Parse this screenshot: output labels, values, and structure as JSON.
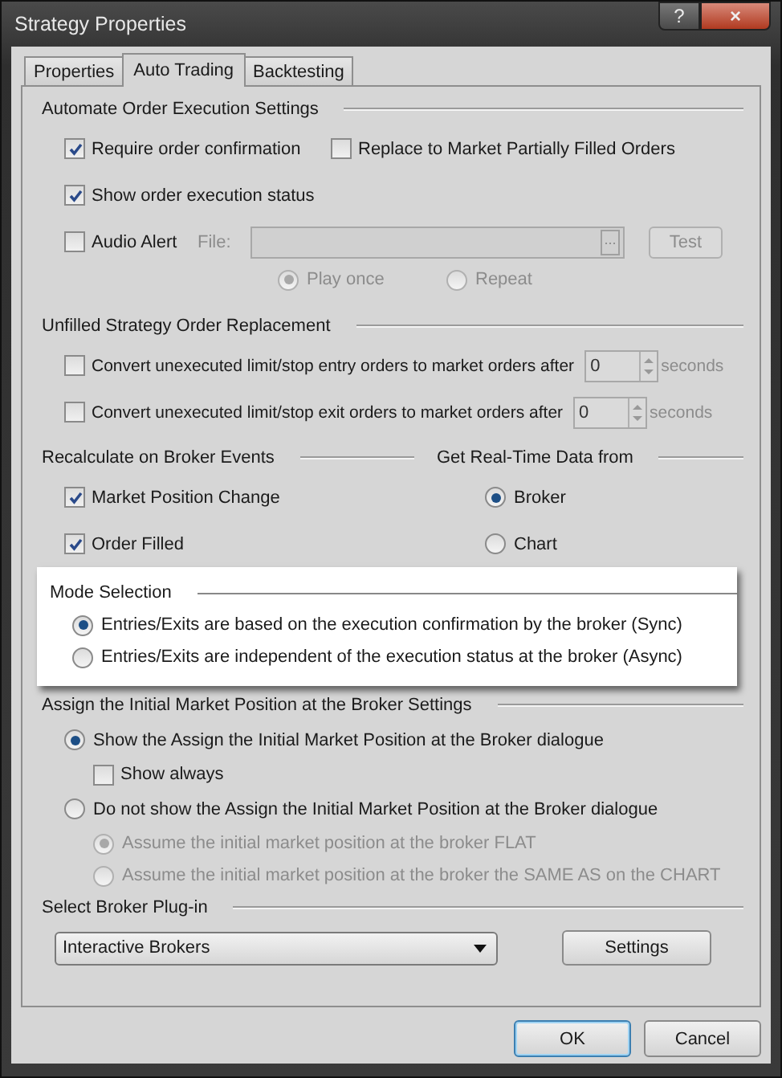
{
  "window": {
    "title": "Strategy Properties",
    "controls": [
      {
        "kind": "help",
        "label": "?"
      },
      {
        "kind": "close",
        "label": "×"
      }
    ]
  },
  "tabs": [
    {
      "label": "Properties",
      "selected": false
    },
    {
      "label": "Auto Trading",
      "selected": true
    },
    {
      "label": "Backtesting",
      "selected": false
    }
  ],
  "automate": {
    "title": "Automate Order Execution Settings",
    "options": [
      {
        "label": "Require order confirmation",
        "checked": true
      },
      {
        "label": "Replace to Market Partially Filled Orders",
        "checked": false
      },
      {
        "label": "Show order execution status",
        "checked": true
      }
    ],
    "audio_alert": {
      "label": "Audio Alert",
      "checked": false
    },
    "file": {
      "label": "File:",
      "browse": "...",
      "disabled": true
    },
    "test_button": {
      "label": "Test",
      "disabled": true
    },
    "playback": [
      {
        "label": "Play once",
        "selected": true,
        "disabled": true
      },
      {
        "label": "Repeat",
        "selected": false,
        "disabled": true
      }
    ]
  },
  "replacement": {
    "title": "Unfilled Strategy Order Replacement",
    "rows": [
      {
        "label": "Convert unexecuted limit/stop entry orders to market orders after",
        "checked": false,
        "value": "0",
        "unit": "seconds",
        "disabled": true
      },
      {
        "label": "Convert unexecuted limit/stop exit orders to market orders after",
        "checked": false,
        "value": "0",
        "unit": "seconds",
        "disabled": true
      }
    ]
  },
  "recalculate": {
    "title": "Recalculate on Broker Events",
    "options": [
      {
        "label": "Market Position Change",
        "checked": true
      },
      {
        "label": "Order Filled",
        "checked": true
      }
    ]
  },
  "realtime": {
    "title": "Get Real-Time Data from",
    "options": [
      {
        "label": "Broker",
        "selected": true
      },
      {
        "label": "Chart",
        "selected": false
      }
    ]
  },
  "mode": {
    "title": "Mode Selection",
    "highlighted": true,
    "options": [
      {
        "label": "Entries/Exits are based on the execution confirmation by the broker (Sync)",
        "selected": true
      },
      {
        "label": "Entries/Exits are independent of the execution status at the broker (Async)",
        "selected": false
      }
    ]
  },
  "initial_position": {
    "title": "Assign the Initial Market Position at the Broker Settings",
    "options": [
      {
        "label": "Show the Assign the Initial Market Position at the Broker dialogue",
        "selected": true,
        "children": [
          {
            "kind": "checkbox",
            "label": "Show always",
            "checked": false,
            "disabled": false
          }
        ]
      },
      {
        "label": "Do not show the Assign the Initial Market Position at the Broker dialogue",
        "selected": false,
        "children": [
          {
            "kind": "radio",
            "label": "Assume the initial market position at the broker FLAT",
            "selected": true,
            "disabled": true
          },
          {
            "kind": "radio",
            "label": "Assume the initial market position at the broker the SAME AS on the CHART",
            "selected": false,
            "disabled": true
          }
        ]
      }
    ]
  },
  "broker": {
    "title": "Select Broker Plug-in",
    "dropdown": {
      "value": "Interactive Brokers"
    },
    "settings_button": {
      "label": "Settings"
    }
  },
  "buttons": [
    {
      "label": "OK",
      "default": true
    },
    {
      "label": "Cancel",
      "default": false
    }
  ]
}
